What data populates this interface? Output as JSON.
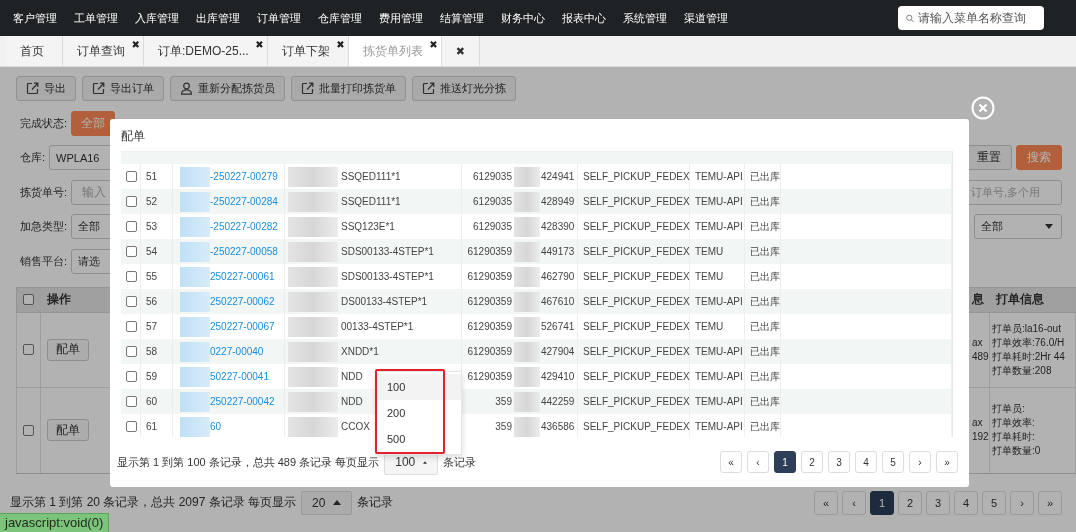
{
  "nav": {
    "menu": [
      "客户管理",
      "工单管理",
      "入库管理",
      "出库管理",
      "订单管理",
      "仓库管理",
      "费用管理",
      "结算管理",
      "财务中心",
      "报表中心",
      "系统管理",
      "渠道管理"
    ],
    "search": {
      "placeholder": "请输入菜单名称查询"
    }
  },
  "tabs": [
    {
      "label": "首页",
      "selected": false
    },
    {
      "label": "订单查询",
      "close": "✖",
      "selected": false
    },
    {
      "label": "订单:DEMO-25...",
      "close": "✖",
      "selected": false
    },
    {
      "label": "订单下架",
      "close": "✖",
      "selected": false
    },
    {
      "label": "拣货单列表",
      "close": "✖",
      "selected": true
    }
  ],
  "close_all_tabs": "✖",
  "toolbar": [
    {
      "label": "导出",
      "kind": "export"
    },
    {
      "label": "导出订单",
      "kind": "export"
    },
    {
      "label": "重新分配拣货员",
      "kind": "person"
    },
    {
      "label": "批量打印拣货单",
      "kind": "export"
    },
    {
      "label": "推送灯光分拣",
      "kind": "export"
    }
  ],
  "filters": {
    "status": {
      "label": "完成状态:",
      "options": [
        {
          "label": "全部",
          "selected": true
        }
      ]
    },
    "warehouse": {
      "label": "仓库:",
      "value": "WPLA16"
    },
    "pick_no": {
      "label": "拣货单号:",
      "placeholder": "输入"
    },
    "urgent": {
      "label": "加急类型:",
      "value": "全部"
    },
    "platform": {
      "label": "销售平台:",
      "value": "请选"
    },
    "order_no": {
      "placeholder": "订单号,多个用"
    },
    "right_select": {
      "value": "全部"
    },
    "reset": "重置",
    "search": "搜索"
  },
  "table": {
    "all_checked": false,
    "columns": {
      "action": "操作",
      "column_3": "息",
      "info": "打单信息"
    },
    "rows": [
      {
        "checked": false,
        "action": "配单",
        "column_3": [
          "ax",
          "489"
        ],
        "info": [
          "打单员:la16-out",
          "打单效率:76.0/H",
          "打单耗时:2Hr 44",
          "打单数量:208"
        ]
      },
      {
        "checked": false,
        "action": "配单",
        "column_3": [
          "ax",
          "192"
        ],
        "info": [
          "打单员:",
          "打单效率:",
          "打单耗时:",
          "打单数量:0"
        ]
      }
    ]
  },
  "pagination": {
    "summary": "显示第 1 到第 20 条记录，总共 2097 条记录 每页显示",
    "page_size": "20",
    "suffix": "条记录",
    "pages": [
      {
        "label": "«",
        "selected": false
      },
      {
        "label": "‹",
        "selected": false
      },
      {
        "label": "1",
        "selected": true
      },
      {
        "label": "2",
        "selected": false
      },
      {
        "label": "3",
        "selected": false
      },
      {
        "label": "4",
        "selected": false
      },
      {
        "label": "5",
        "selected": false
      },
      {
        "label": "›",
        "selected": false
      },
      {
        "label": "»",
        "selected": false
      }
    ]
  },
  "modal": {
    "title": "配单",
    "rows": [
      {
        "checked": false,
        "no": "51",
        "order": "-250227-00279",
        "sku": "SSQED111*1",
        "track_a": "6129035",
        "track_b": "424941",
        "carrier": "SELF_PICKUP_FEDEX",
        "platform": "TEMU-API",
        "status": "已出库"
      },
      {
        "checked": false,
        "no": "52",
        "order": "-250227-00284",
        "sku": "SSQED111*1",
        "track_a": "6129035",
        "track_b": "428949",
        "carrier": "SELF_PICKUP_FEDEX",
        "platform": "TEMU-API",
        "status": "已出库"
      },
      {
        "checked": false,
        "no": "53",
        "order": "-250227-00282",
        "sku": "SSQ123E*1",
        "track_a": "6129035",
        "track_b": "428390",
        "carrier": "SELF_PICKUP_FEDEX",
        "platform": "TEMU-API",
        "status": "已出库"
      },
      {
        "checked": false,
        "no": "54",
        "order": "-250227-00058",
        "sku": "SDS00133-4STEP*1",
        "track_a": "61290359",
        "track_b": "449173",
        "carrier": "SELF_PICKUP_FEDEX",
        "platform": "TEMU",
        "status": "已出库"
      },
      {
        "checked": false,
        "no": "55",
        "order": "250227-00061",
        "sku": "SDS00133-4STEP*1",
        "track_a": "61290359",
        "track_b": "462790",
        "carrier": "SELF_PICKUP_FEDEX",
        "platform": "TEMU",
        "status": "已出库"
      },
      {
        "checked": false,
        "no": "56",
        "order": "250227-00062",
        "sku": "DS00133-4STEP*1",
        "track_a": "61290359",
        "track_b": "467610",
        "carrier": "SELF_PICKUP_FEDEX",
        "platform": "TEMU-API",
        "status": "已出库"
      },
      {
        "checked": false,
        "no": "57",
        "order": "250227-00067",
        "sku": "00133-4STEP*1",
        "track_a": "61290359",
        "track_b": "526741",
        "carrier": "SELF_PICKUP_FEDEX",
        "platform": "TEMU",
        "status": "已出库"
      },
      {
        "checked": false,
        "no": "58",
        "order": "0227-00040",
        "sku": "XNDD*1",
        "track_a": "61290359",
        "track_b": "427904",
        "carrier": "SELF_PICKUP_FEDEX",
        "platform": "TEMU-API",
        "status": "已出库"
      },
      {
        "checked": false,
        "no": "59",
        "order": "50227-00041",
        "sku": "NDD",
        "track_a": "61290359",
        "track_b": "429410",
        "carrier": "SELF_PICKUP_FEDEX",
        "platform": "TEMU-API",
        "status": "已出库"
      },
      {
        "checked": false,
        "no": "60",
        "order": "250227-00042",
        "sku": "NDD",
        "track_a": "359",
        "track_b": "442259",
        "carrier": "SELF_PICKUP_FEDEX",
        "platform": "TEMU-API",
        "status": "已出库"
      },
      {
        "checked": false,
        "no": "61",
        "order": "60",
        "sku": "CCOX",
        "track_a": "359",
        "track_b": "436586",
        "carrier": "SELF_PICKUP_FEDEX",
        "platform": "TEMU-API",
        "status": "已出库"
      }
    ],
    "footer": {
      "summary": "显示第 1 到第 100 条记录，总共 489 条记录 每页显示",
      "page_size": "100",
      "suffix": "条记录",
      "size_menu": {
        "highlighted": true,
        "options": [
          {
            "label": "100",
            "selected": true
          },
          {
            "label": "200",
            "selected": false
          },
          {
            "label": "500",
            "selected": false
          }
        ]
      },
      "pages": [
        {
          "label": "«",
          "selected": false
        },
        {
          "label": "‹",
          "selected": false
        },
        {
          "label": "1",
          "selected": true
        },
        {
          "label": "2",
          "selected": false
        },
        {
          "label": "3",
          "selected": false
        },
        {
          "label": "4",
          "selected": false
        },
        {
          "label": "5",
          "selected": false
        },
        {
          "label": "›",
          "selected": false
        },
        {
          "label": "»",
          "selected": false
        }
      ]
    }
  },
  "status_url": "javascript:void(0)"
}
